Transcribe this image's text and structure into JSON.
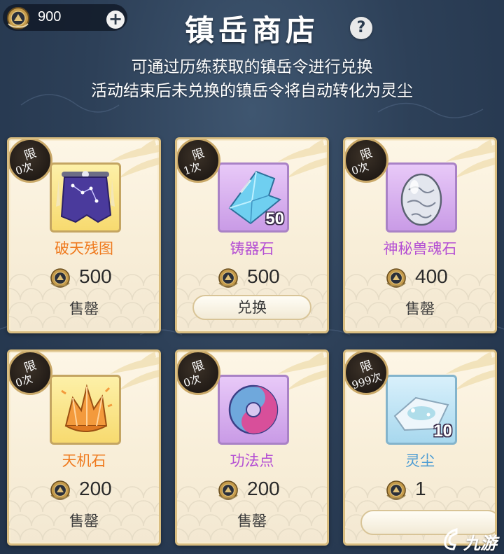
{
  "currency": {
    "amount": "900",
    "plus": "+"
  },
  "title": "镇岳商店",
  "help": "?",
  "subtitles": [
    "可通过历练获取的镇岳令进行兑换",
    "活动结束后未兑换的镇岳令将自动转化为灵尘"
  ],
  "items": [
    {
      "limit_label": "限",
      "limit_count": "0次",
      "name": "破天残图",
      "price": "500",
      "status": "售罄",
      "qty": "",
      "rarity": "gold",
      "icon": "star-map-scroll-icon"
    },
    {
      "limit_label": "限",
      "limit_count": "1次",
      "name": "铸器石",
      "price": "500",
      "button": "兑换",
      "qty": "50",
      "rarity": "purple",
      "icon": "blue-crystal-icon"
    },
    {
      "limit_label": "限",
      "limit_count": "0次",
      "name": "神秘兽魂石",
      "price": "400",
      "status": "售罄",
      "qty": "",
      "rarity": "purple",
      "icon": "beast-soul-egg-icon"
    },
    {
      "limit_label": "限",
      "limit_count": "0次",
      "name": "天机石",
      "price": "200",
      "status": "售罄",
      "qty": "",
      "rarity": "gold",
      "icon": "orange-crystal-icon"
    },
    {
      "limit_label": "限",
      "limit_count": "0次",
      "name": "功法点",
      "price": "200",
      "status": "售罄",
      "qty": "",
      "rarity": "purple",
      "icon": "swirl-orb-icon"
    },
    {
      "limit_label": "限",
      "limit_count": "999次",
      "name": "灵尘",
      "price": "1",
      "button": "",
      "qty": "10",
      "rarity": "blue",
      "icon": "spirit-dust-icon"
    }
  ],
  "watermark": {
    "text": "九游"
  },
  "colors": {
    "gold_name": "#ef7a1e",
    "purple_name": "#b44fd4",
    "blue_name": "#4b9bd3",
    "card_border": "#d9bd80"
  }
}
